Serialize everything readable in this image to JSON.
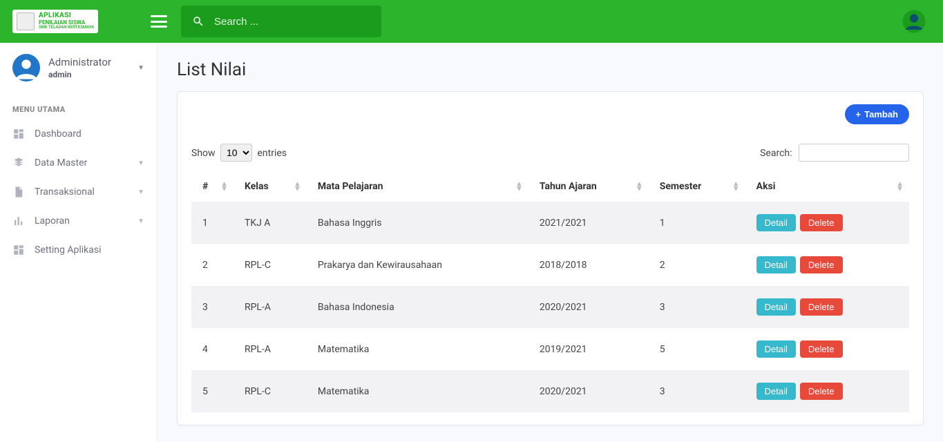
{
  "brand": {
    "line1": "APLIKASI",
    "line2": "PENILAIAN SISWA",
    "line3": "SMK TELADAN KERTASMAYA"
  },
  "search": {
    "placeholder": "Search ..."
  },
  "user": {
    "name": "Administrator",
    "role": "admin"
  },
  "menu": {
    "heading": "MENU UTAMA",
    "items": [
      {
        "label": "Dashboard",
        "expandable": false
      },
      {
        "label": "Data Master",
        "expandable": true
      },
      {
        "label": "Transaksional",
        "expandable": true
      },
      {
        "label": "Laporan",
        "expandable": true
      },
      {
        "label": "Setting Aplikasi",
        "expandable": false
      }
    ]
  },
  "page": {
    "title": "List Nilai"
  },
  "buttons": {
    "add": "Tambah",
    "detail": "Detail",
    "delete": "Delete"
  },
  "table_ctl": {
    "show": "Show",
    "entries": "entries",
    "page_size": "10",
    "search_label": "Search:"
  },
  "columns": [
    "#",
    "Kelas",
    "Mata Pelajaran",
    "Tahun Ajaran",
    "Semester",
    "Aksi"
  ],
  "rows": [
    {
      "n": "1",
      "kelas": "TKJ A",
      "mapel": "Bahasa Inggris",
      "tahun": "2021/2021",
      "sem": "1"
    },
    {
      "n": "2",
      "kelas": "RPL-C",
      "mapel": "Prakarya dan Kewirausahaan",
      "tahun": "2018/2018",
      "sem": "2"
    },
    {
      "n": "3",
      "kelas": "RPL-A",
      "mapel": "Bahasa Indonesia",
      "tahun": "2020/2021",
      "sem": "3"
    },
    {
      "n": "4",
      "kelas": "RPL-A",
      "mapel": "Matematika",
      "tahun": "2019/2021",
      "sem": "5"
    },
    {
      "n": "5",
      "kelas": "RPL-C",
      "mapel": "Matematika",
      "tahun": "2020/2021",
      "sem": "3"
    }
  ]
}
